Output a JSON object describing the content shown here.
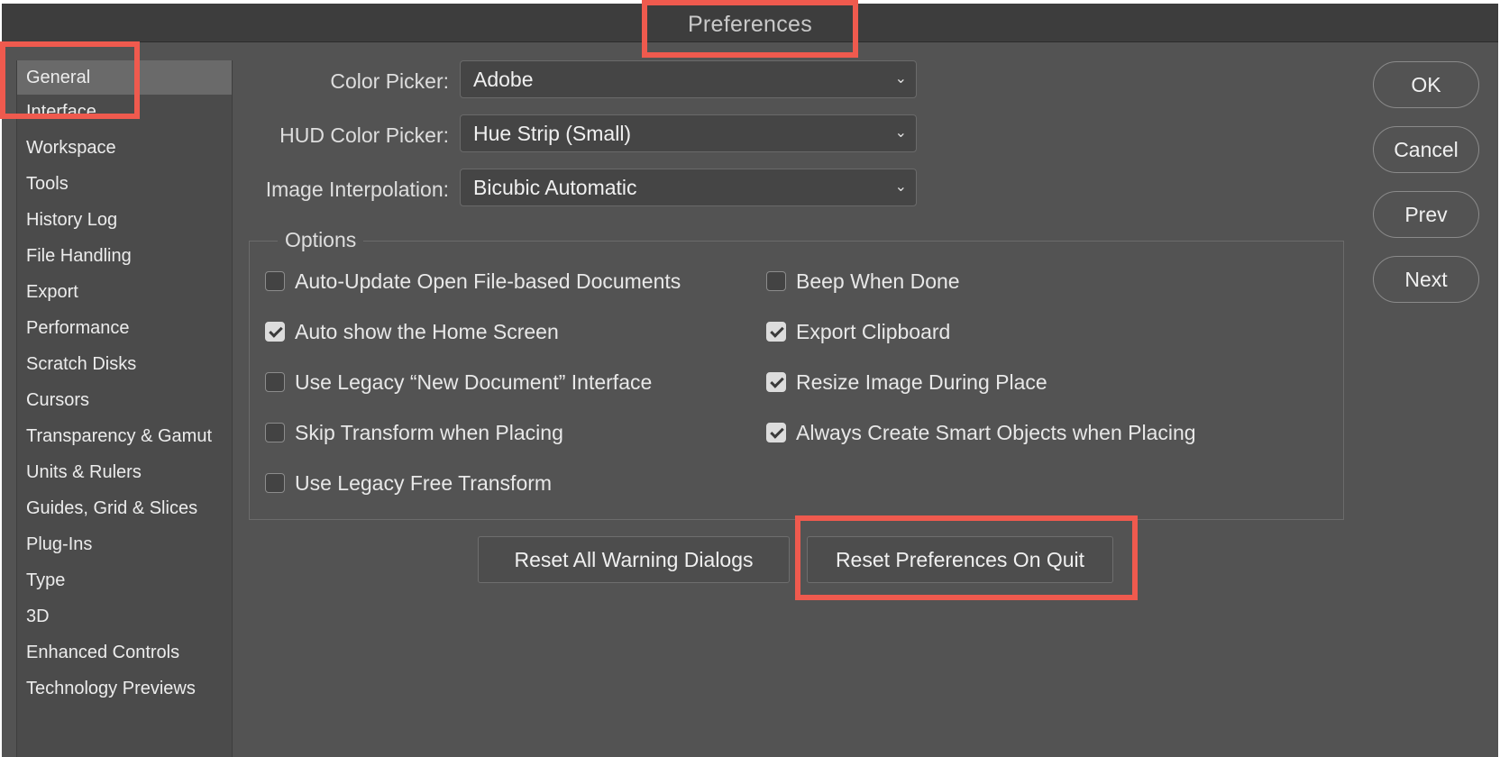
{
  "window": {
    "title": "Preferences"
  },
  "sidebar": {
    "items": [
      {
        "label": "General",
        "selected": true
      },
      {
        "label": "Interface"
      },
      {
        "label": "Workspace"
      },
      {
        "label": "Tools"
      },
      {
        "label": "History Log"
      },
      {
        "label": "File Handling"
      },
      {
        "label": "Export"
      },
      {
        "label": "Performance"
      },
      {
        "label": "Scratch Disks"
      },
      {
        "label": "Cursors"
      },
      {
        "label": "Transparency & Gamut"
      },
      {
        "label": "Units & Rulers"
      },
      {
        "label": "Guides, Grid & Slices"
      },
      {
        "label": "Plug-Ins"
      },
      {
        "label": "Type"
      },
      {
        "label": "3D"
      },
      {
        "label": "Enhanced Controls"
      },
      {
        "label": "Technology Previews"
      }
    ]
  },
  "fields": {
    "color_picker": {
      "label": "Color Picker:",
      "value": "Adobe"
    },
    "hud_color_picker": {
      "label": "HUD Color Picker:",
      "value": "Hue Strip (Small)"
    },
    "image_interpolation": {
      "label": "Image Interpolation:",
      "value": "Bicubic Automatic"
    }
  },
  "options": {
    "legend": "Options",
    "left": [
      {
        "label": "Auto-Update Open File-based Documents",
        "checked": false
      },
      {
        "label": "Auto show the Home Screen",
        "checked": true
      },
      {
        "label": "Use Legacy “New Document” Interface",
        "checked": false
      },
      {
        "label": "Skip Transform when Placing",
        "checked": false
      },
      {
        "label": "Use Legacy Free Transform",
        "checked": false
      }
    ],
    "right": [
      {
        "label": "Beep When Done",
        "checked": false
      },
      {
        "label": "Export Clipboard",
        "checked": true
      },
      {
        "label": "Resize Image During Place",
        "checked": true
      },
      {
        "label": "Always Create Smart Objects when Placing",
        "checked": true
      }
    ]
  },
  "buttons": {
    "ok": "OK",
    "cancel": "Cancel",
    "prev": "Prev",
    "next": "Next",
    "reset_warnings": "Reset All Warning Dialogs",
    "reset_prefs": "Reset Preferences On Quit"
  },
  "colors": {
    "highlight": "#ef5a4e",
    "panel": "#535353",
    "titlebar": "#3d3d3d"
  },
  "icons": {
    "dropdown": "chevron-down-icon",
    "check": "checkmark-icon"
  }
}
